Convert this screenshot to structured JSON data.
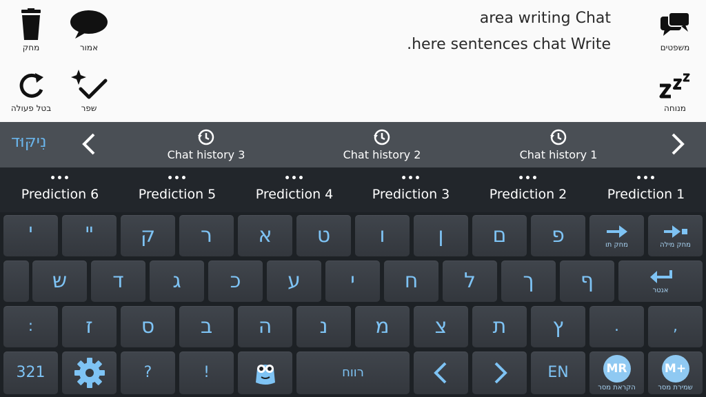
{
  "tools": {
    "delete_label": "מחק",
    "say_label": "אמור",
    "undo_label": "בטל פעולה",
    "improve_label": "שפר",
    "sentences_label": "משפטים",
    "rest_label": "מנוחה"
  },
  "message": {
    "line1": "area writing Chat",
    "line2": ".here sentences chat Write"
  },
  "history": {
    "niqqud_label": "נִיקּוּד",
    "items": [
      "Chat history 3",
      "Chat history 2",
      "Chat history 1"
    ]
  },
  "predictions": {
    "dots": "•••",
    "items": [
      "Prediction 6",
      "Prediction 5",
      "Prediction 4",
      "Prediction 3",
      "Prediction 2",
      "Prediction 1"
    ]
  },
  "keyboard": {
    "row1": [
      "'",
      "\"",
      "ק",
      "ר",
      "א",
      "ט",
      "ו",
      "ן",
      "ם",
      "פ"
    ],
    "delete_char_label": "מחק תו",
    "delete_word_label": "מחק מילה",
    "row2": [
      "ש",
      "ד",
      "ג",
      "כ",
      "ע",
      "י",
      "ח",
      "ל",
      "ך",
      "ף"
    ],
    "enter_label": "אנטר",
    "row3": [
      ":",
      "ז",
      "ס",
      "ב",
      "ה",
      "נ",
      "מ",
      "צ",
      "ת",
      "ץ",
      ".",
      ","
    ],
    "numbers_label": "321",
    "question": "?",
    "exclaim": "!",
    "space_label": "רווח",
    "lang_label": "EN",
    "mr_text": "MR",
    "mr_label": "הקראת מסר",
    "mplus_text": "M+",
    "mplus_label": "שמירת מסר"
  },
  "colors": {
    "accent": "#7ec3f4",
    "keyboard_bg": "#1d2125",
    "history_bg": "#4a4f55",
    "top_bg": "#fafafa"
  }
}
